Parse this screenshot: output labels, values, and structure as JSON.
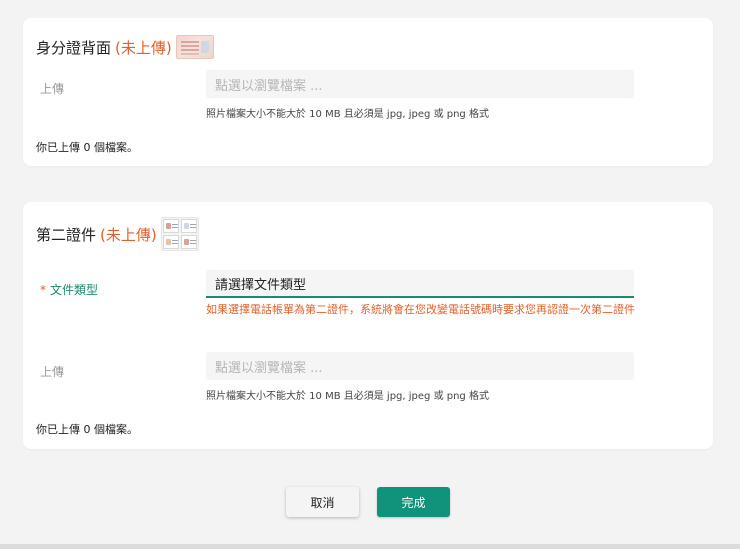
{
  "card_back": {
    "title": "身分證背面",
    "status": "(未上傳)",
    "upload_label": "上傳",
    "upload_placeholder": "點選以瀏覽檔案 ...",
    "hint": "照片檔案大小不能大於 10 MB 且必須是 jpg, jpeg 或 png 格式",
    "upload_count": "你已上傳 0 個檔案。"
  },
  "card_second": {
    "title": "第二證件",
    "status": "(未上傳)",
    "doc_type_required_mark": "*",
    "doc_type_label": "文件類型",
    "doc_type_value": "請選擇文件類型",
    "warning": "如果選擇電話帳單為第二證件，系統將會在您改變電話號碼時要求您再認證一次第二證件",
    "upload_label": "上傳",
    "upload_placeholder": "點選以瀏覽檔案 ...",
    "hint": "照片檔案大小不能大於 10 MB 且必須是 jpg, jpeg 或 png 格式",
    "upload_count": "你已上傳 0 個檔案。"
  },
  "actions": {
    "cancel_label": "取消",
    "done_label": "完成"
  },
  "colors": {
    "accent": "#10937a",
    "status": "#e0612c",
    "required_label": "#1f8a6f"
  }
}
